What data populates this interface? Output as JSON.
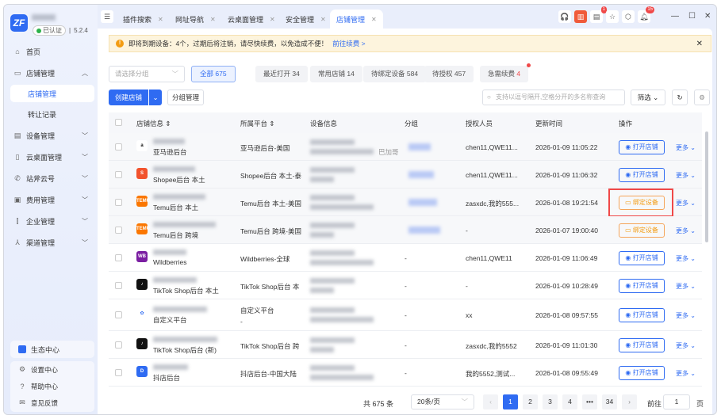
{
  "app": {
    "version": "5.2.4",
    "verified": "已认证"
  },
  "sidebar": {
    "items": [
      {
        "label": "首页",
        "icon": "home-icon"
      },
      {
        "label": "店铺管理",
        "icon": "store-icon"
      },
      {
        "label": "店铺管理"
      },
      {
        "label": "转让记录"
      },
      {
        "label": "设备管理",
        "icon": "device-icon"
      },
      {
        "label": "云桌面管理",
        "icon": "cloud-desktop-icon"
      },
      {
        "label": "站斧云号",
        "icon": "phone-icon"
      },
      {
        "label": "费用管理",
        "icon": "fee-icon"
      },
      {
        "label": "企业管理",
        "icon": "enterprise-icon"
      },
      {
        "label": "渠道管理",
        "icon": "channel-icon"
      }
    ],
    "eco": "生态中心",
    "settings": "设置中心",
    "help": "帮助中心",
    "feedback": "意见反馈"
  },
  "tabs": [
    {
      "label": "插件搜索"
    },
    {
      "label": "网址导航"
    },
    {
      "label": "云桌面管理"
    },
    {
      "label": "安全管理"
    },
    {
      "label": "店铺管理"
    }
  ],
  "toolbar": {
    "doc_badge": "1",
    "bell_badge": "15"
  },
  "notice": {
    "text": "即将到期设备：4个，过期后将注销，请尽快续费，以免造成不便！",
    "link": "前往续费 >"
  },
  "filters": {
    "group_placeholder": "请选择分组",
    "chips": [
      {
        "label": "全部",
        "count": "675"
      },
      {
        "label": "最近打开",
        "count": "34"
      },
      {
        "label": "常用店铺",
        "count": "14"
      },
      {
        "label": "待绑定设备",
        "count": "584"
      },
      {
        "label": "待授权",
        "count": "457"
      },
      {
        "label": "急需续费",
        "count": "4"
      }
    ]
  },
  "actions": {
    "create": "创建店铺",
    "group_manage": "分组管理",
    "search_placeholder": "支持以逗号隔开,空格分开的多名称查询",
    "filter": "筛选"
  },
  "table": {
    "headers": [
      "店铺信息",
      "所属平台",
      "设备信息",
      "分组",
      "授权人员",
      "更新时间",
      "操作"
    ],
    "rows": [
      {
        "platform_name": "亚马逊后台",
        "platform": "亚马逊后台-美国",
        "device_extra": "巴加哥",
        "auth": "chen11,QWE11...",
        "time": "2026-01-09 11:05:22",
        "action": "打开店铺"
      },
      {
        "platform_name": "Shopee后台 本土",
        "platform": "Shopee后台 本土-泰",
        "auth": "chen11,QWE11...",
        "time": "2026-01-09 11:06:32",
        "action": "打开店铺"
      },
      {
        "platform_name": "Temu后台 本土",
        "platform": "Temu后台 本土-美国",
        "auth": "zasxdc,我的555...",
        "time": "2026-01-08 19:21:54",
        "action": "绑定设备"
      },
      {
        "platform_name": "Temu后台 跨境",
        "platform": "Temu后台 跨境-美国",
        "auth": "-",
        "time": "2026-01-07 19:00:40",
        "action": "绑定设备"
      },
      {
        "platform_name": "Wildberries",
        "platform": "Wildberries-全球",
        "group": "-",
        "auth": "chen11,QWE11",
        "time": "2026-01-09 11:06:49",
        "action": "打开店铺"
      },
      {
        "platform_name": "TikTok Shop后台 本土",
        "platform": "TikTok Shop后台 本",
        "group": "-",
        "auth": "-",
        "time": "2026-01-09 10:28:49",
        "action": "打开店铺"
      },
      {
        "platform_name": "自定义平台",
        "platform": "自定义平台",
        "platform2": "-",
        "group": "-",
        "auth": "xx",
        "time": "2026-01-08 09:57:55",
        "action": "打开店铺"
      },
      {
        "platform_name": "TikTok Shop后台 (新)",
        "platform": "TikTok Shop后台 跨",
        "group": "-",
        "auth": "zasxdc,我的5552",
        "time": "2026-01-09 11:01:30",
        "action": "打开店铺"
      },
      {
        "platform_name": "抖店后台",
        "platform": "抖店后台-中国大陆",
        "group": "-",
        "auth": "我的5552,测试...",
        "time": "2026-01-08 09:55:49",
        "action": "打开店铺"
      }
    ],
    "more": "更多"
  },
  "pagination": {
    "total": "共 675 条",
    "page_size": "20条/页",
    "pages": [
      "1",
      "2",
      "3",
      "4",
      "•••",
      "34"
    ],
    "current": "1",
    "goto_label": "前往",
    "goto_value": "1",
    "page_unit": "页"
  }
}
